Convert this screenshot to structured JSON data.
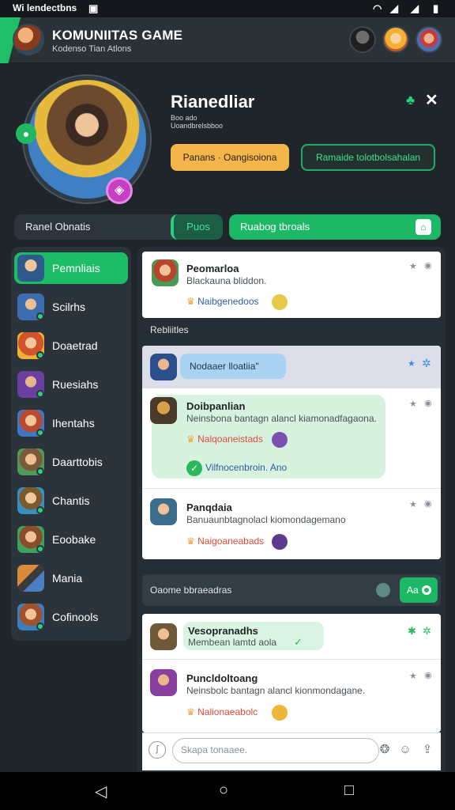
{
  "status_bar": {
    "text": "Wi lendectbns",
    "icons": [
      "notification-icon",
      "wifi-icon",
      "signal-icon",
      "battery-icon"
    ]
  },
  "app_bar": {
    "title": "KOMUNIITAS GAME",
    "subtitle": "Kodenso Tian Atlons"
  },
  "profile": {
    "name": "Rianedliar",
    "line1": "Boo ado",
    "line2": "Uoandbrelsbboo",
    "primary_button": "Panans · Oangisoiona",
    "secondary_button": "Ramaide tolotbolsahalan"
  },
  "tabs": {
    "left_label": "Ranel Obnatis",
    "left_pill": "Puos",
    "right_label": "Ruabog tbroals"
  },
  "sidebar": {
    "items": [
      {
        "label": "Pemnliais",
        "active": true
      },
      {
        "label": "Scilrhs"
      },
      {
        "label": "Doaetrad"
      },
      {
        "label": "Ruesiahs"
      },
      {
        "label": "Ihentahs"
      },
      {
        "label": "Daarttobis"
      },
      {
        "label": "Chantis"
      },
      {
        "label": "Eoobake"
      },
      {
        "label": "Mania"
      },
      {
        "label": "Cofinools"
      }
    ]
  },
  "feed": {
    "post1": {
      "title": "Peomarloa",
      "text": "Blackauna bliddon.",
      "meta": "Naibgenedoos"
    },
    "section_label": "Rebliitles",
    "group_pill": "Nodaaer lloatiia\"",
    "post2": {
      "title": "Doibpanlian",
      "text": "Neinsbona bantagn alancl kiamonadfagaona.",
      "meta": "Nalqoaneistads",
      "reply": "Vilfnocenbroin. Ano"
    },
    "post3": {
      "title": "Panqdaia",
      "text": "Banuaunbtagnolacl kiomondagemano",
      "meta": "Naigoaneabads"
    },
    "footer_label": "Oaome bbraeadras",
    "footer_button": "Aa",
    "post4": {
      "title": "Vesopranadhs",
      "text": "Membean lamtd aola"
    },
    "post5": {
      "title": "Puncldoltoang",
      "text": "Neinsbolc bantagn alancl kionmondagane.",
      "meta": "Nalionaeabolc"
    },
    "input_placeholder": "Skapa tonaaee."
  },
  "colors": {
    "accent": "#1cb866",
    "background": "#1f252b",
    "orange": "#f4b64a"
  }
}
